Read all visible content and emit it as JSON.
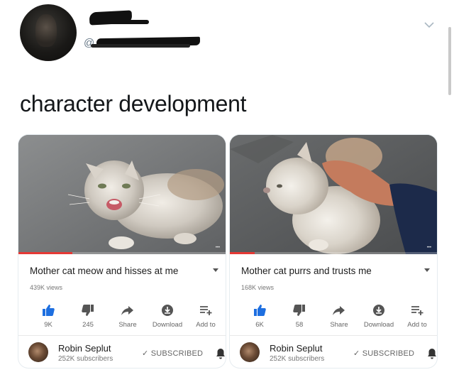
{
  "tweet": {
    "handle_prefix": "@",
    "text": "character development"
  },
  "cards": [
    {
      "video_title": "Mother cat meow and hisses at me",
      "views": "439K views",
      "progress": 0.26,
      "actions": [
        {
          "icon": "thumbs-up-icon",
          "label": "9K",
          "accent": "#1e6fe0"
        },
        {
          "icon": "thumbs-down-icon",
          "label": "245",
          "accent": "#555555"
        },
        {
          "icon": "share-icon",
          "label": "Share",
          "accent": "#555555"
        },
        {
          "icon": "download-icon",
          "label": "Download",
          "accent": "#555555"
        },
        {
          "icon": "add-to-playlist-icon",
          "label": "Add to",
          "accent": "#555555"
        }
      ],
      "channel": {
        "name": "Robin Seplut",
        "subscribers": "252K subscribers",
        "subscribe_state": "SUBSCRIBED"
      }
    },
    {
      "video_title": "Mother cat purrs and trusts me",
      "views": "168K views",
      "progress": 0.12,
      "actions": [
        {
          "icon": "thumbs-up-icon",
          "label": "6K",
          "accent": "#1e6fe0"
        },
        {
          "icon": "thumbs-down-icon",
          "label": "58",
          "accent": "#555555"
        },
        {
          "icon": "share-icon",
          "label": "Share",
          "accent": "#555555"
        },
        {
          "icon": "download-icon",
          "label": "Download",
          "accent": "#555555"
        },
        {
          "icon": "add-to-playlist-icon",
          "label": "Add to",
          "accent": "#555555"
        }
      ],
      "channel": {
        "name": "Robin Seplut",
        "subscribers": "252K subscribers",
        "subscribe_state": "SUBSCRIBED"
      }
    }
  ],
  "colors": {
    "like_active": "#1e6fe0",
    "progress": "#e53935",
    "text_secondary": "#777777"
  }
}
